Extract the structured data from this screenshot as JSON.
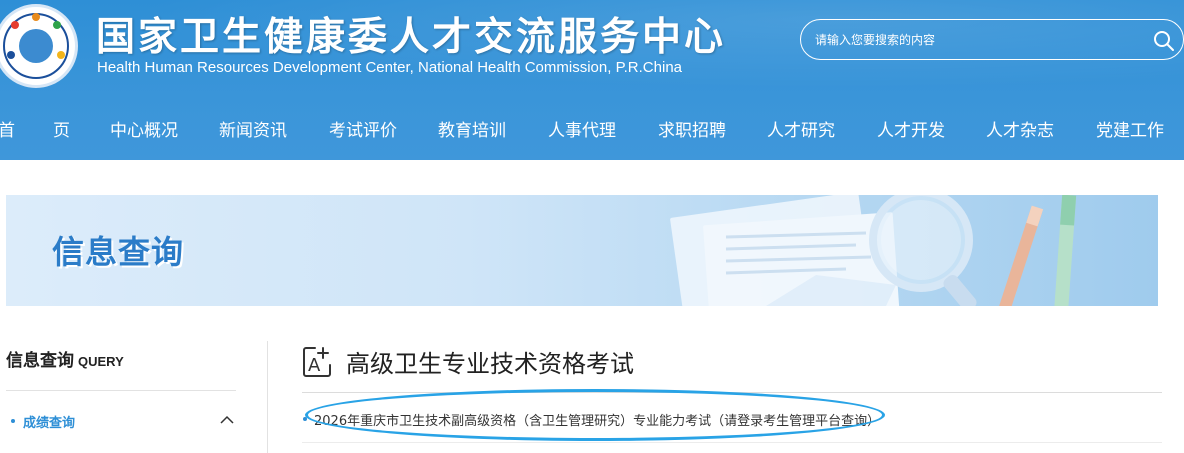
{
  "header": {
    "title_cn": "国家卫生健康委人才交流服务中心",
    "title_en": "Health Human Resources Development Center, National Health Commission, P.R.China",
    "search": {
      "placeholder": "请输入您要搜索的内容",
      "value": ""
    },
    "icons": {
      "search": "search-icon",
      "logo": "center-logo-emblem"
    }
  },
  "nav": {
    "items": [
      {
        "label": "首",
        "name": "nav-home-first-char"
      },
      {
        "label": "页",
        "name": "nav-home-second-char"
      },
      {
        "label": "中心概况"
      },
      {
        "label": "新闻资讯"
      },
      {
        "label": "考试评价"
      },
      {
        "label": "教育培训"
      },
      {
        "label": "人事代理"
      },
      {
        "label": "求职招聘"
      },
      {
        "label": "人才研究"
      },
      {
        "label": "人才开发"
      },
      {
        "label": "人才杂志"
      },
      {
        "label": "党建工作"
      }
    ]
  },
  "banner": {
    "title": "信息查询"
  },
  "sidebar": {
    "title": "信息查询",
    "title_en": "QUERY",
    "items": [
      {
        "label": "成绩查询",
        "expanded": true
      }
    ]
  },
  "main": {
    "title": "高级卫生专业技术资格考试",
    "list": [
      {
        "text": "2026年重庆市卫生技术副高级资格（含卫生管理研究）专业能力考试（请登录考生管理平台查询）",
        "highlighted": true
      }
    ]
  },
  "colors": {
    "header_blue": "#2e8fd6",
    "link_blue": "#2e8fd6",
    "banner_title": "#2b7cc8",
    "highlight_oval": "#29a3e6"
  }
}
